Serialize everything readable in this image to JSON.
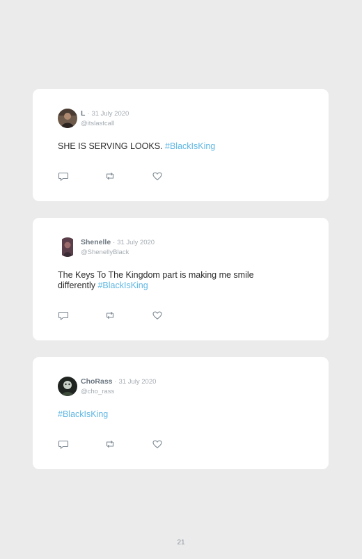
{
  "tweets": [
    {
      "name": "L",
      "date": "31 July 2020",
      "handle": "@itslastcall",
      "text": "SHE IS SERVING LOOKS.",
      "hashtag": "#BlackIsKing"
    },
    {
      "name": "Shenelle",
      "date": "31 July 2020",
      "handle": "@ShenellyBlack",
      "text": "The Keys To The Kingdom part is making me smile differently",
      "hashtag": "#BlackIsKing"
    },
    {
      "name": "ChoRass",
      "date": "31 July 2020",
      "handle": "@cho_rass",
      "text": "",
      "hashtag": "#BlackIsKing"
    }
  ],
  "separator": "·",
  "page_number": "21",
  "icons": [
    "comment-icon",
    "retweet-icon",
    "like-icon"
  ],
  "colors": {
    "background": "#ebebeb",
    "card": "#ffffff",
    "hashtag": "#5fb7e4",
    "meta": "#a5acb3"
  }
}
